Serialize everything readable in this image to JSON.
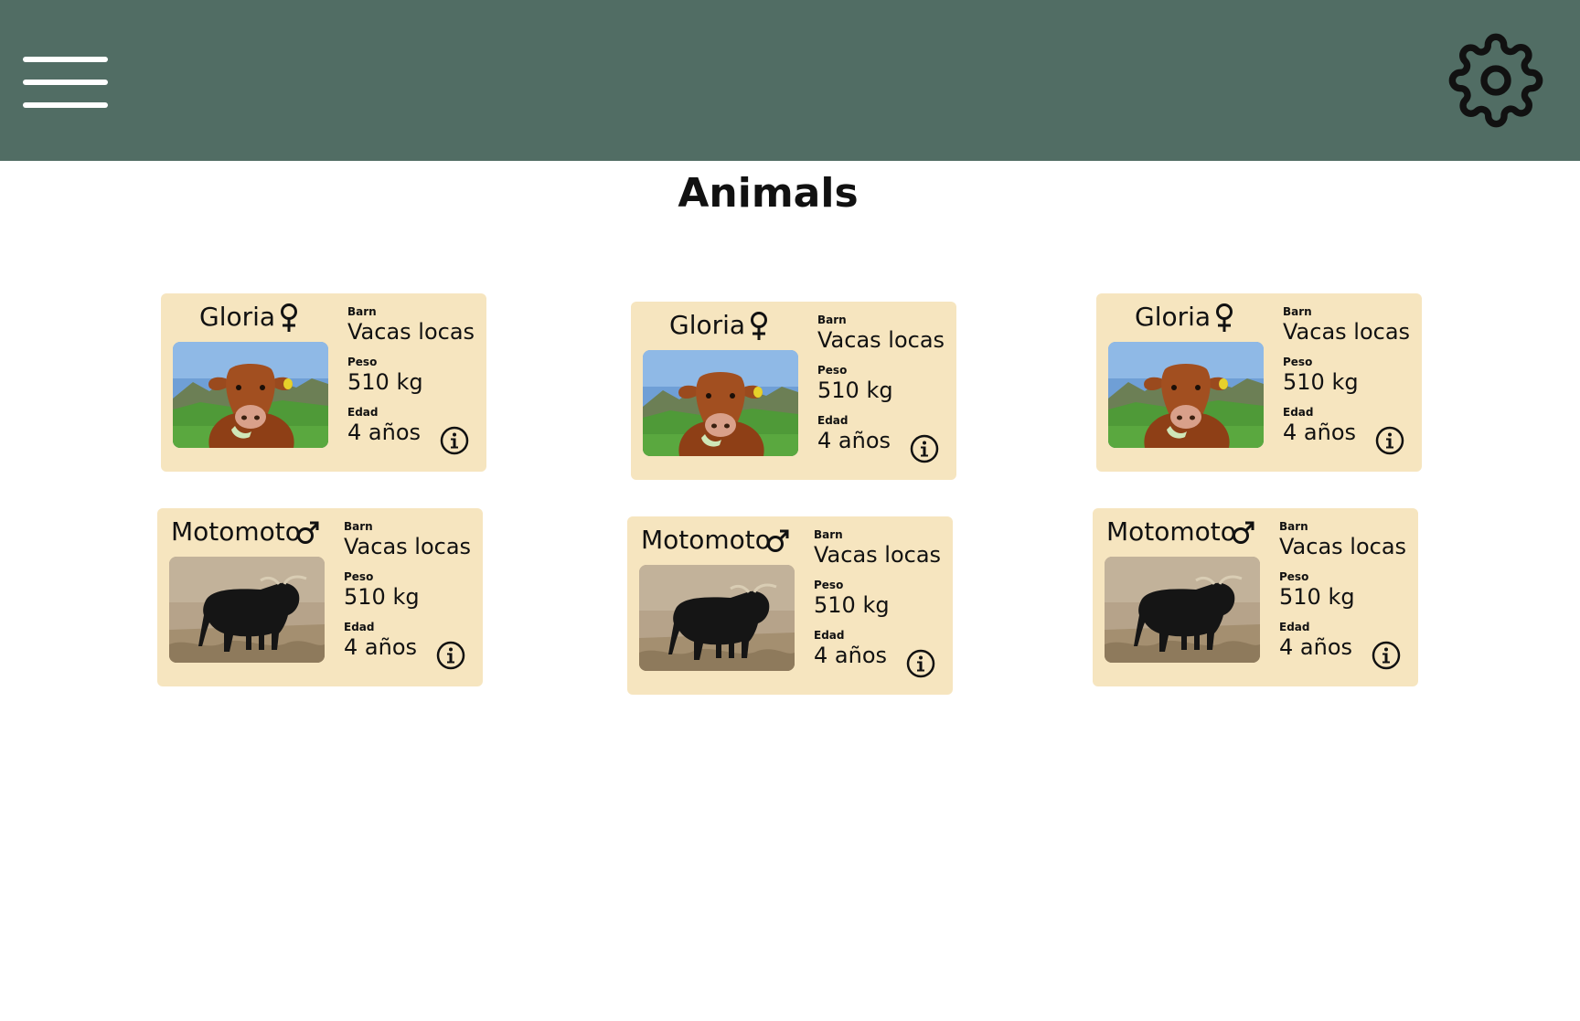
{
  "header": {
    "menu_icon": "hamburger-menu-icon",
    "settings_icon": "gear-icon",
    "background": "#516d64"
  },
  "page": {
    "title": "Animals"
  },
  "card_background": "#f6e5bf",
  "animals": [
    {
      "name": "Gloria",
      "sex": "female",
      "sex_icon": "female-symbol-icon",
      "photo": "brown-cow-photo",
      "barn_label": "Barn",
      "barn": "Vacas locas",
      "peso_label": "Peso",
      "peso": "510 kg",
      "edad_label": "Edad",
      "edad": "4 años"
    },
    {
      "name": "Gloria",
      "sex": "female",
      "sex_icon": "female-symbol-icon",
      "photo": "brown-cow-photo",
      "barn_label": "Barn",
      "barn": "Vacas locas",
      "peso_label": "Peso",
      "peso": "510 kg",
      "edad_label": "Edad",
      "edad": "4 años"
    },
    {
      "name": "Gloria",
      "sex": "female",
      "sex_icon": "female-symbol-icon",
      "photo": "brown-cow-photo",
      "barn_label": "Barn",
      "barn": "Vacas locas",
      "peso_label": "Peso",
      "peso": "510 kg",
      "edad_label": "Edad",
      "edad": "4 años"
    },
    {
      "name": "Motomoto",
      "sex": "male",
      "sex_icon": "male-symbol-icon",
      "photo": "black-bull-photo",
      "barn_label": "Barn",
      "barn": "Vacas locas",
      "peso_label": "Peso",
      "peso": "510 kg",
      "edad_label": "Edad",
      "edad": "4 años"
    },
    {
      "name": "Motomoto",
      "sex": "male",
      "sex_icon": "male-symbol-icon",
      "photo": "black-bull-photo",
      "barn_label": "Barn",
      "barn": "Vacas locas",
      "peso_label": "Peso",
      "peso": "510 kg",
      "edad_label": "Edad",
      "edad": "4 años"
    },
    {
      "name": "Motomoto",
      "sex": "male",
      "sex_icon": "male-symbol-icon",
      "photo": "black-bull-photo",
      "barn_label": "Barn",
      "barn": "Vacas locas",
      "peso_label": "Peso",
      "peso": "510 kg",
      "edad_label": "Edad",
      "edad": "4 años"
    }
  ]
}
